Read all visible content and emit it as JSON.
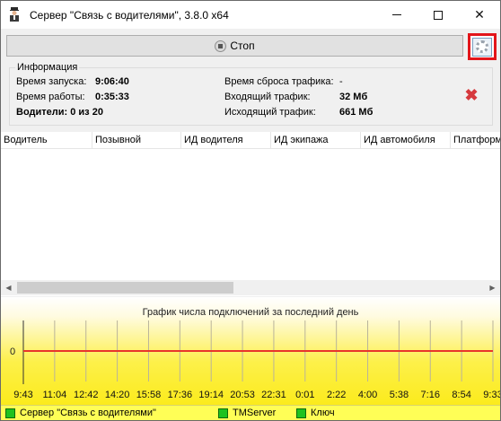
{
  "window": {
    "title": "Сервер \"Связь с водителями\", 3.8.0 x64",
    "app_icon": "driver-person-icon",
    "controls": [
      "minimize-icon",
      "maximize-icon",
      "close-icon"
    ]
  },
  "toolbar": {
    "stop_label": "Стоп",
    "stop_icon": "stop-circle-icon",
    "settings_icon": "gear-icon",
    "highlight_color": "#e3151a"
  },
  "info": {
    "group_title": "Информация",
    "start_time_label": "Время запуска:",
    "start_time_value": "9:06:40",
    "uptime_label": "Время работы:",
    "uptime_value": "0:35:33",
    "drivers_label": "Водители: 0 из 20",
    "traffic_reset_label": "Время сброса трафика:",
    "traffic_reset_value": "-",
    "incoming_label": "Входящий трафик:",
    "incoming_value": "32 Мб",
    "outgoing_label": "Исходящий трафик:",
    "outgoing_value": "661 Мб",
    "delete_icon": "red-x-icon"
  },
  "table": {
    "columns": [
      "Водитель",
      "Позывной",
      "ИД водителя",
      "ИД экипажа",
      "ИД автомобиля",
      "Платформ"
    ],
    "rows": []
  },
  "chart_data": {
    "type": "line",
    "title": "График числа подключений за последний день",
    "x": [
      "9:43",
      "11:04",
      "12:42",
      "14:20",
      "15:58",
      "17:36",
      "19:14",
      "20:53",
      "22:31",
      "0:01",
      "2:22",
      "4:00",
      "5:38",
      "7:16",
      "8:54",
      "9:33"
    ],
    "series": [
      {
        "values": [
          0,
          0,
          0,
          0,
          0,
          0,
          0,
          0,
          0,
          0,
          0,
          0,
          0,
          0,
          0,
          0
        ],
        "color": "#e8352b"
      }
    ],
    "yticks": [
      "0"
    ],
    "grid": true,
    "background": [
      "#ffffff",
      "#fbeb1c"
    ]
  },
  "statusbar": {
    "items": [
      {
        "label": "Сервер \"Связь с водителями\"",
        "color": "#1fc21f"
      },
      {
        "label": "TMServer",
        "color": "#1fc21f"
      },
      {
        "label": "Ключ",
        "color": "#1fc21f"
      }
    ]
  }
}
